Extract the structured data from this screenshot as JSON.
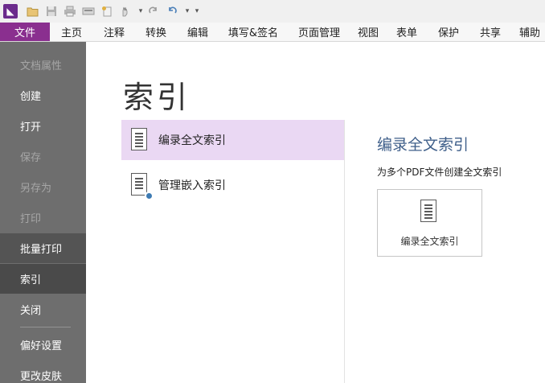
{
  "toolbar": {
    "icons": [
      "app-logo",
      "open-folder",
      "save",
      "print",
      "scan",
      "new-star",
      "hand-tool",
      "dropdown-arrow",
      "redo",
      "undo",
      "dropdown-arrow",
      "customize"
    ],
    "logo_glyph": "◣"
  },
  "tabs": {
    "file": "文件",
    "home": "主页",
    "comment": "注释",
    "convert": "转换",
    "edit": "编辑",
    "fill_sign": "填写&签名",
    "page_manage": "页面管理",
    "view": "视图",
    "form": "表单",
    "protect": "保护",
    "share": "共享",
    "assist": "辅助"
  },
  "sidebar": {
    "items": [
      {
        "label": "文档属性",
        "state": "disabled"
      },
      {
        "label": "创建",
        "state": "normal"
      },
      {
        "label": "打开",
        "state": "normal"
      },
      {
        "label": "保存",
        "state": "disabled"
      },
      {
        "label": "另存为",
        "state": "disabled"
      },
      {
        "label": "打印",
        "state": "disabled"
      },
      {
        "label": "批量打印",
        "state": "normal"
      },
      {
        "label": "索引",
        "state": "active"
      },
      {
        "label": "关闭",
        "state": "normal"
      },
      {
        "label": "偏好设置",
        "state": "normal"
      },
      {
        "label": "更改皮肤",
        "state": "normal"
      }
    ]
  },
  "main": {
    "title": "索引",
    "options": [
      {
        "label": "编录全文索引",
        "icon": "document-index-icon",
        "selected": true
      },
      {
        "label": "管理嵌入索引",
        "icon": "document-settings-icon",
        "selected": false
      }
    ],
    "detail": {
      "title": "编录全文索引",
      "description": "为多个PDF文件创建全文索引",
      "action_label": "编录全文索引"
    }
  },
  "colors": {
    "accent": "#8a2f8f",
    "sidebar_bg": "#6e6e6e",
    "selected_bg": "#ead8f3",
    "detail_title": "#3f5f8a"
  }
}
